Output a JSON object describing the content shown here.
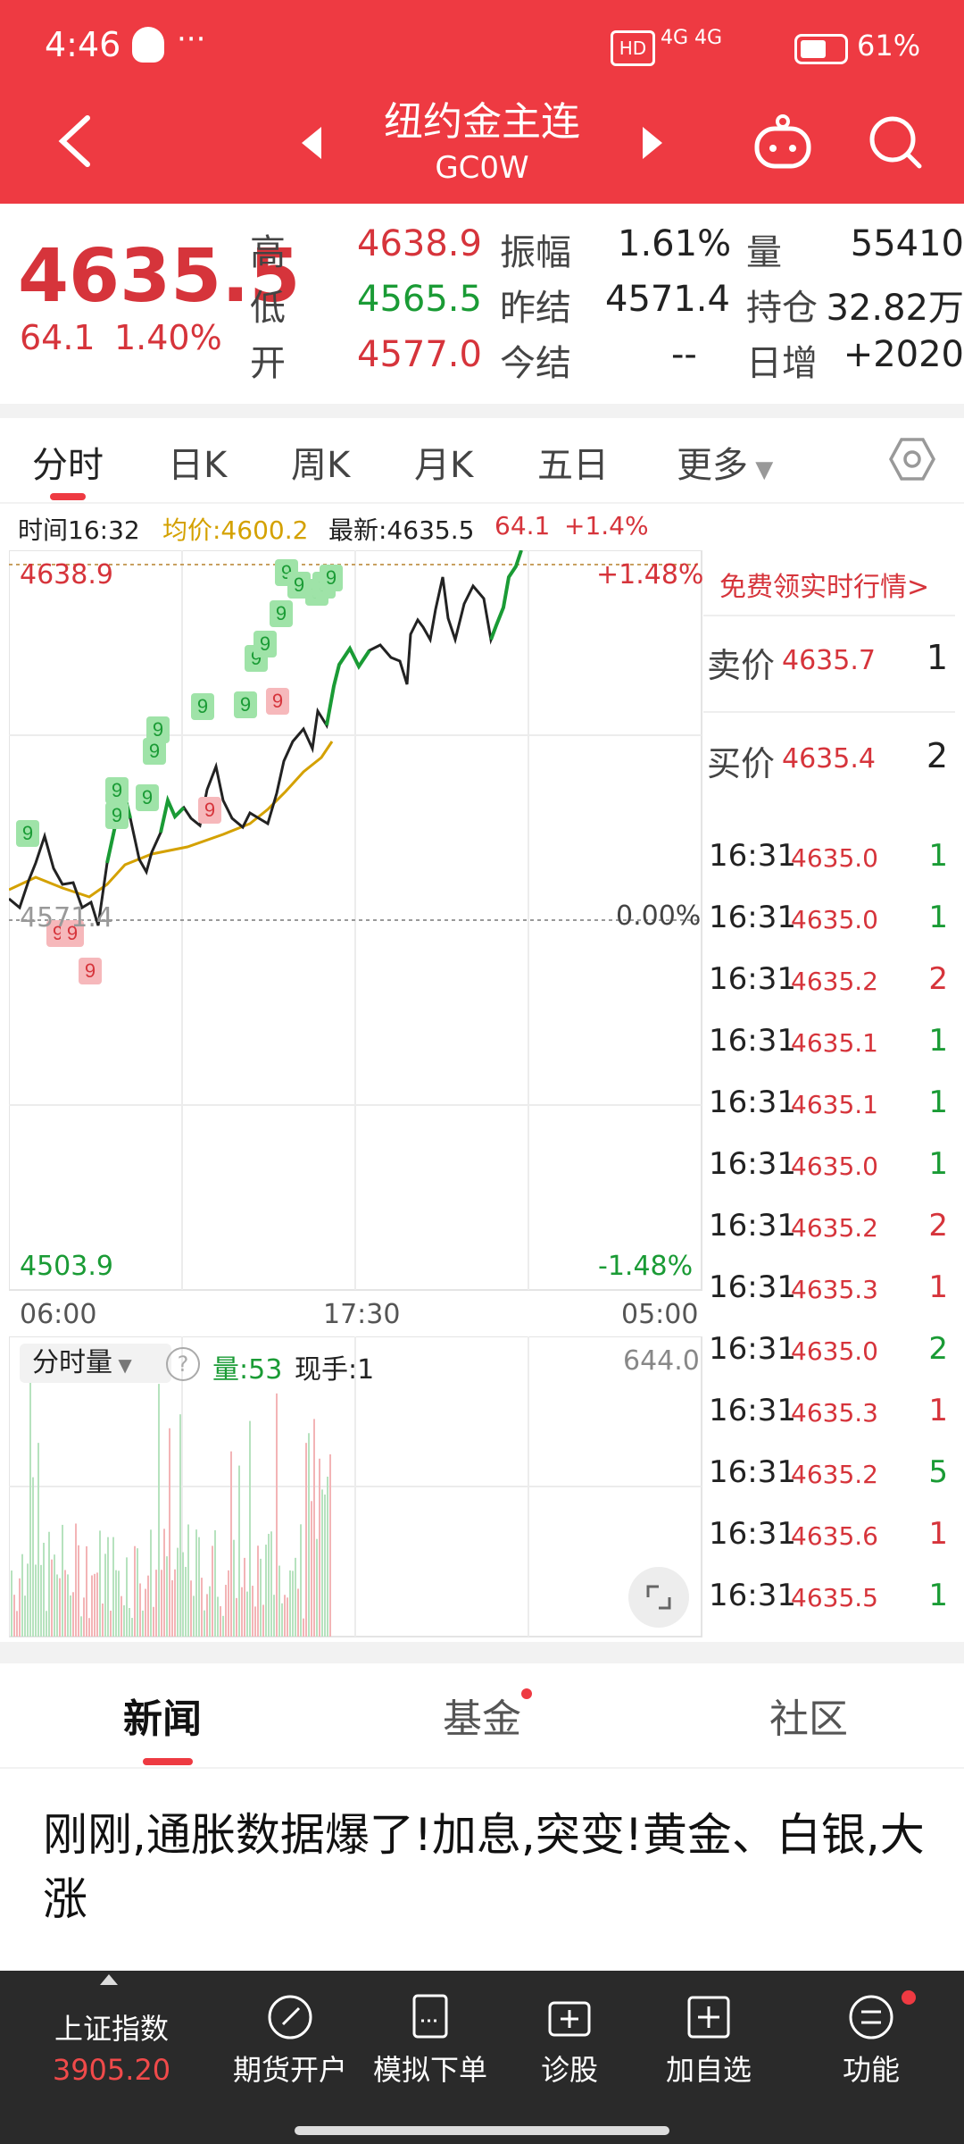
{
  "status": {
    "time": "4:46",
    "carrier_icons": "qq-icon",
    "more": "···",
    "network": "4G 4G",
    "battery": "61%"
  },
  "header": {
    "title": "纽约金主连",
    "subtitle": "GC0W"
  },
  "quote": {
    "price": "4635.5",
    "change": "64.1",
    "change_pct": "1.40%",
    "high_label": "高",
    "high": "4638.9",
    "low_label": "低",
    "low": "4565.5",
    "open_label": "开",
    "open": "4577.0",
    "amp_label": "振幅",
    "amp": "1.61%",
    "prev_settle_label": "昨结",
    "prev_settle": "4571.4",
    "today_settle_label": "今结",
    "today_settle": "--",
    "vol_label": "量",
    "vol": "55410",
    "oi_label": "持仓",
    "oi": "32.82万",
    "daily_inc_label": "日增",
    "daily_inc": "+2020"
  },
  "tabs": [
    "分时",
    "日K",
    "周K",
    "月K",
    "五日",
    "更多"
  ],
  "chart_info": {
    "time": "时间16:32",
    "avg": "均价:4600.2",
    "latest": "最新:4635.5",
    "chg": "64.1",
    "pct": "+1.4%"
  },
  "chart": {
    "top_price": "4638.9",
    "top_pct": "+1.48%",
    "mid_price": "4571.4",
    "mid_pct": "0.00%",
    "bottom_price": "4503.9",
    "bottom_pct": "-1.48%",
    "x_start": "06:00",
    "x_mid": "17:30",
    "x_end": "05:00"
  },
  "volume": {
    "selector": "分时量",
    "vol": "量:53",
    "hand": "现手:1",
    "max": "644.0"
  },
  "orderbook": {
    "promo": "免费领实时行情>",
    "sell_label": "卖价",
    "sell_price": "4635.7",
    "sell_qty": "1",
    "buy_label": "买价",
    "buy_price": "4635.4",
    "buy_qty": "2"
  },
  "ticks": [
    {
      "t": "16:31",
      "p": "4635.0",
      "q": "1",
      "c": "green"
    },
    {
      "t": "16:31",
      "p": "4635.0",
      "q": "1",
      "c": "green"
    },
    {
      "t": "16:31",
      "p": "4635.2",
      "q": "2",
      "c": "red"
    },
    {
      "t": "16:31",
      "p": "4635.1",
      "q": "1",
      "c": "green"
    },
    {
      "t": "16:31",
      "p": "4635.1",
      "q": "1",
      "c": "green"
    },
    {
      "t": "16:31",
      "p": "4635.0",
      "q": "1",
      "c": "green"
    },
    {
      "t": "16:31",
      "p": "4635.2",
      "q": "2",
      "c": "red"
    },
    {
      "t": "16:31",
      "p": "4635.3",
      "q": "1",
      "c": "red"
    },
    {
      "t": "16:31",
      "p": "4635.0",
      "q": "2",
      "c": "green"
    },
    {
      "t": "16:31",
      "p": "4635.3",
      "q": "1",
      "c": "red"
    },
    {
      "t": "16:31",
      "p": "4635.2",
      "q": "5",
      "c": "green"
    },
    {
      "t": "16:31",
      "p": "4635.6",
      "q": "1",
      "c": "red"
    },
    {
      "t": "16:31",
      "p": "4635.5",
      "q": "1",
      "c": "green"
    }
  ],
  "news": {
    "tabs": [
      "新闻",
      "基金",
      "社区"
    ],
    "headline": "刚刚,通胀数据爆了!加息,突变!黄金、白银,大涨"
  },
  "bottom_nav": {
    "index_name": "上证指数",
    "index_value": "3905.20",
    "items": [
      "期货开户",
      "模拟下单",
      "诊股",
      "加自选",
      "功能"
    ]
  },
  "colors": {
    "brand": "#ee3a42",
    "up": "#d6343b",
    "down": "#1a9b35"
  }
}
